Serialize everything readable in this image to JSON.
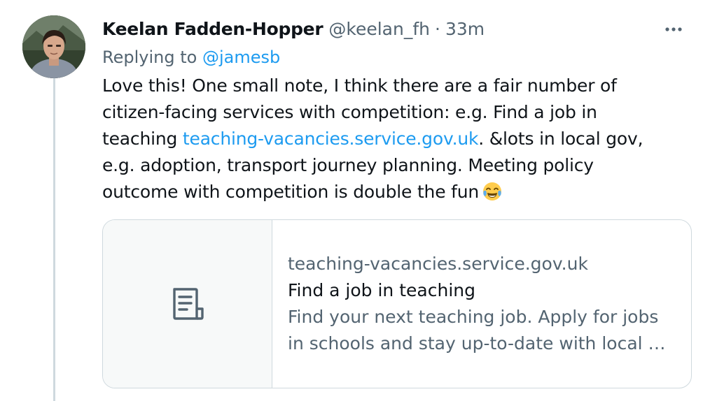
{
  "author": {
    "name": "Keelan Fadden-Hopper",
    "handle": "@keelan_fh",
    "separator": "·",
    "time": "33m"
  },
  "more_icon": "more-horizontal-icon",
  "reply": {
    "prefix": "Replying to",
    "mention": "@jamesb"
  },
  "body": {
    "line1": "Love this! One small note, I think there are a fair number of",
    "line2": "citizen-facing services with competition: e.g. Find a job in",
    "line3_before": "teaching ",
    "line3_link": "teaching-vacancies.service.gov.uk",
    "line3_after": ". &lots in local gov,",
    "line4": "e.g. adoption, transport journey planning. Meeting policy",
    "line5": "outcome with competition is double the fun",
    "emoji": "face-with-tears-of-joy-icon"
  },
  "card": {
    "thumb_icon": "document-icon",
    "domain": "teaching-vacancies.service.gov.uk",
    "title": "Find a job in teaching",
    "desc_line1": "Find your next teaching job. Apply for jobs",
    "desc_line2": "in schools and stay up-to-date with local …"
  },
  "colors": {
    "link": "#1d9bf0",
    "secondary": "#536471",
    "border": "#cfd9de",
    "thread_line": "#cfd9de"
  }
}
